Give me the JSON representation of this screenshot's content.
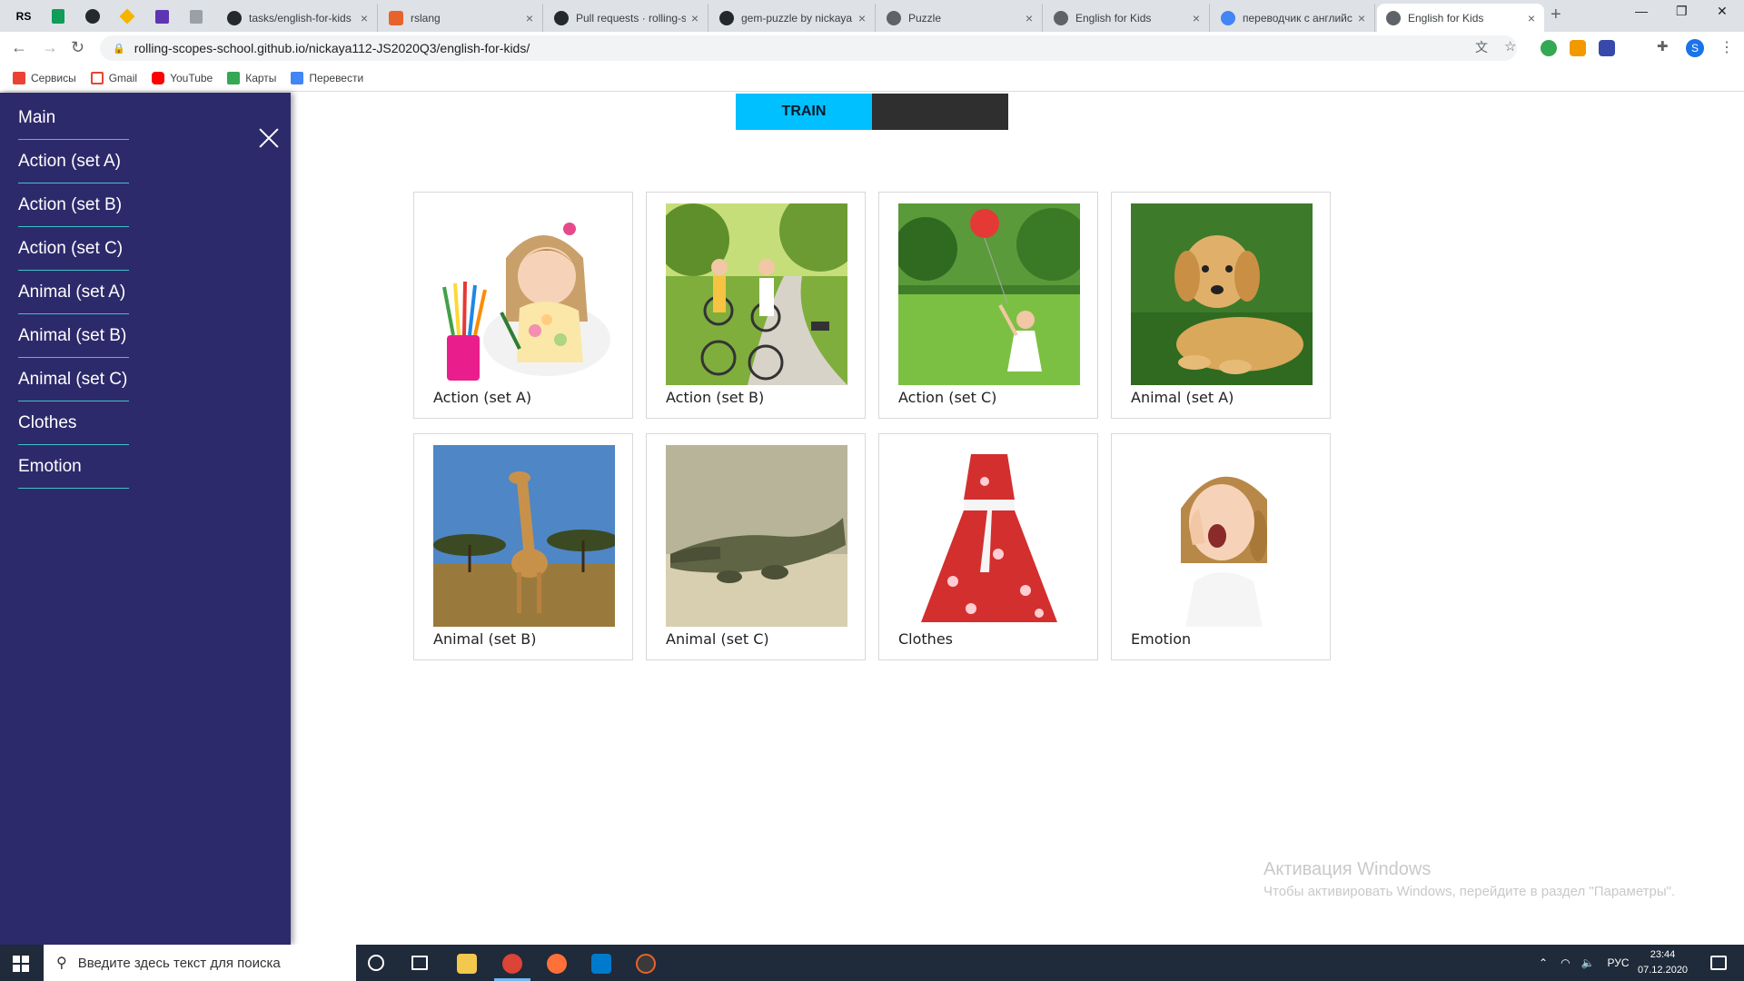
{
  "browser": {
    "pinned_tabs": [
      "RS",
      "Sheets",
      "GitHub",
      "Jira",
      "Notes",
      "Docs"
    ],
    "tabs": [
      {
        "title": "tasks/english-for-kids",
        "active": false
      },
      {
        "title": "rslang",
        "active": false
      },
      {
        "title": "Pull requests · rolling-s",
        "active": false
      },
      {
        "title": "gem-puzzle by nickaya",
        "active": false
      },
      {
        "title": "Puzzle",
        "active": false
      },
      {
        "title": "English for Kids",
        "active": false
      },
      {
        "title": "переводчик с английс",
        "active": false
      },
      {
        "title": "English for Kids",
        "active": true
      }
    ],
    "url": "rolling-scopes-school.github.io/nickaya112-JS2020Q3/english-for-kids/",
    "bookmarks": [
      "Сервисы",
      "Gmail",
      "YouTube",
      "Карты",
      "Перевести"
    ],
    "profile_initial": "S"
  },
  "sidebar": {
    "items": [
      {
        "label": "Main"
      },
      {
        "label": "Action (set A)"
      },
      {
        "label": "Action (set B)"
      },
      {
        "label": "Action (set C)"
      },
      {
        "label": "Animal (set A)"
      },
      {
        "label": "Animal (set B)"
      },
      {
        "label": "Animal (set C)"
      },
      {
        "label": "Clothes"
      },
      {
        "label": "Emotion"
      }
    ]
  },
  "mode_switch": {
    "train_label": "TRAIN",
    "play_label": ""
  },
  "cards": [
    {
      "label": "Action (set A)",
      "image": "girl-drawing"
    },
    {
      "label": "Action (set B)",
      "image": "kids-cycling"
    },
    {
      "label": "Action (set C)",
      "image": "girl-with-balloon"
    },
    {
      "label": "Animal (set A)",
      "image": "puppy"
    },
    {
      "label": "Animal (set B)",
      "image": "giraffe"
    },
    {
      "label": "Animal (set C)",
      "image": "crocodile"
    },
    {
      "label": "Clothes",
      "image": "red-dress"
    },
    {
      "label": "Emotion",
      "image": "yawning-girl"
    }
  ],
  "watermark": {
    "title": "Активация Windows",
    "subtitle": "Чтобы активировать Windows, перейдите в раздел \"Параметры\"."
  },
  "taskbar": {
    "search_placeholder": "Введите здесь текст для поиска",
    "language": "РУС",
    "time": "23:44",
    "date": "07.12.2020"
  },
  "colors": {
    "sidebar_bg": "#2d2a6b",
    "menu_divider": "#3fc1c9",
    "train_bg": "#00c0ff",
    "play_bg": "#2f2f2f"
  }
}
